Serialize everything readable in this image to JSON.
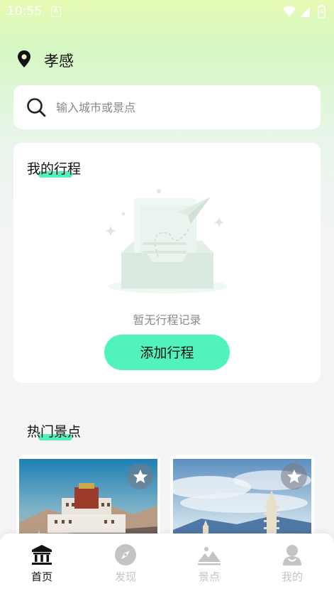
{
  "status_bar": {
    "time": "10:55",
    "notification_glyph": "A"
  },
  "location": {
    "city": "孝感",
    "icon": "location-pin-icon"
  },
  "search": {
    "placeholder": "输入城市或景点",
    "icon": "search-icon"
  },
  "my_trips": {
    "title": "我的行程",
    "empty_text": "暂无行程记录",
    "add_button_label": "添加行程"
  },
  "hot_spots": {
    "title": "热门景点",
    "cards": [
      {
        "image": "potala-palace-photo",
        "favorite_icon": "star-icon"
      },
      {
        "image": "pagoda-mountain-photo",
        "favorite_icon": "star-icon"
      }
    ]
  },
  "tabbar": {
    "items": [
      {
        "label": "首页",
        "icon": "temple-home-icon",
        "active": true
      },
      {
        "label": "发现",
        "icon": "compass-icon",
        "active": false
      },
      {
        "label": "景点",
        "icon": "mountain-icon",
        "active": false
      },
      {
        "label": "我的",
        "icon": "user-icon",
        "active": false
      }
    ]
  },
  "colors": {
    "accent": "#52f2bd",
    "highlight": "#55f0b8",
    "inactive_tab": "#c4c4c4"
  }
}
